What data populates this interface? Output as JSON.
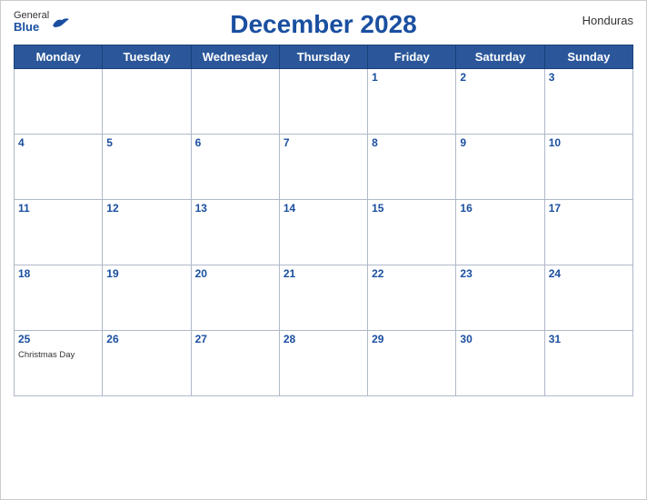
{
  "header": {
    "logo_general": "General",
    "logo_blue": "Blue",
    "title": "December 2028",
    "country": "Honduras"
  },
  "weekdays": [
    "Monday",
    "Tuesday",
    "Wednesday",
    "Thursday",
    "Friday",
    "Saturday",
    "Sunday"
  ],
  "weeks": [
    [
      {
        "day": "",
        "empty": true
      },
      {
        "day": "",
        "empty": true
      },
      {
        "day": "",
        "empty": true
      },
      {
        "day": "",
        "empty": true
      },
      {
        "day": "1"
      },
      {
        "day": "2"
      },
      {
        "day": "3"
      }
    ],
    [
      {
        "day": "4"
      },
      {
        "day": "5"
      },
      {
        "day": "6"
      },
      {
        "day": "7"
      },
      {
        "day": "8"
      },
      {
        "day": "9"
      },
      {
        "day": "10"
      }
    ],
    [
      {
        "day": "11"
      },
      {
        "day": "12"
      },
      {
        "day": "13"
      },
      {
        "day": "14"
      },
      {
        "day": "15"
      },
      {
        "day": "16"
      },
      {
        "day": "17"
      }
    ],
    [
      {
        "day": "18"
      },
      {
        "day": "19"
      },
      {
        "day": "20"
      },
      {
        "day": "21"
      },
      {
        "day": "22"
      },
      {
        "day": "23"
      },
      {
        "day": "24"
      }
    ],
    [
      {
        "day": "25",
        "event": "Christmas Day"
      },
      {
        "day": "26"
      },
      {
        "day": "27"
      },
      {
        "day": "28"
      },
      {
        "day": "29"
      },
      {
        "day": "30"
      },
      {
        "day": "31"
      }
    ]
  ]
}
